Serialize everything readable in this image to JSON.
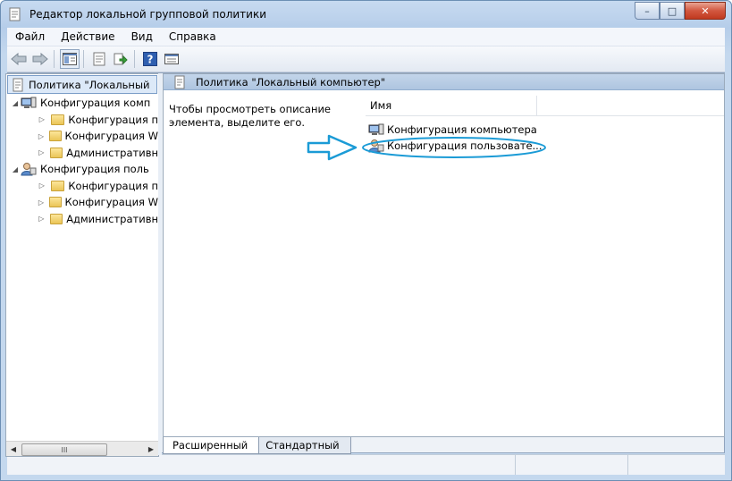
{
  "window": {
    "title": "Редактор локальной групповой политики",
    "caption_icons": [
      "minimize-icon",
      "maximize-icon",
      "close-icon"
    ]
  },
  "menu": [
    "Файл",
    "Действие",
    "Вид",
    "Справка"
  ],
  "toolbar": {
    "icons": [
      "back-icon",
      "forward-icon",
      "tree-toggle-icon",
      "properties-icon",
      "export-icon",
      "help-icon",
      "view-icon"
    ]
  },
  "tree": {
    "root": "Политика \"Локальный",
    "nodes": [
      {
        "label": "Конфигурация комп",
        "level": 1,
        "icon": "computer-icon"
      },
      {
        "label": "Конфигурация п",
        "level": 2,
        "icon": "folder-icon"
      },
      {
        "label": "Конфигурация W",
        "level": 2,
        "icon": "folder-icon"
      },
      {
        "label": "Административн",
        "level": 2,
        "icon": "folder-icon"
      },
      {
        "label": "Конфигурация поль",
        "level": 1,
        "icon": "user-icon"
      },
      {
        "label": "Конфигурация п",
        "level": 2,
        "icon": "folder-icon"
      },
      {
        "label": "Конфигурация W",
        "level": 2,
        "icon": "folder-icon"
      },
      {
        "label": "Административн",
        "level": 2,
        "icon": "folder-icon"
      }
    ],
    "scroll_thumb": "III"
  },
  "details": {
    "header": "Политика \"Локальный компьютер\"",
    "description": "Чтобы просмотреть описание элемента, выделите его.",
    "column": "Имя",
    "items": [
      {
        "label": "Конфигурация компьютера",
        "icon": "computer-icon"
      },
      {
        "label": "Конфигурация пользовате...",
        "icon": "user-icon"
      }
    ]
  },
  "tabs": [
    "Расширенный",
    "Стандартный"
  ],
  "annotation": {
    "arrow_color": "#1b9bd6",
    "circle_color": "#1b9bd6"
  }
}
